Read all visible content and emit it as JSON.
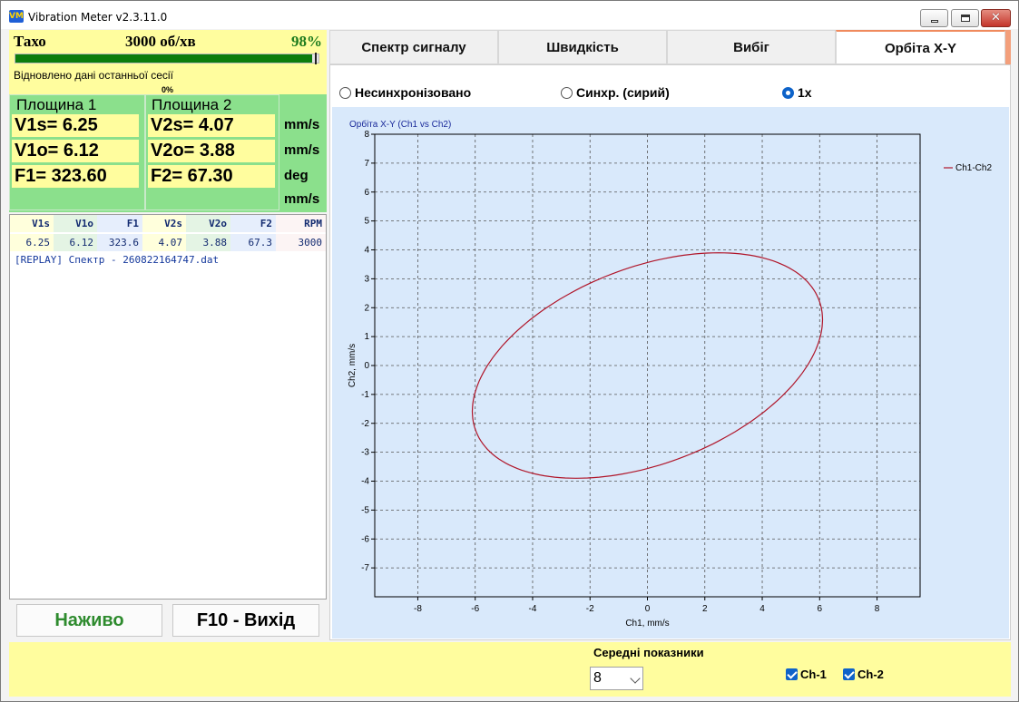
{
  "window": {
    "title": "Vibration Meter v2.3.11.0",
    "icon": "VM"
  },
  "tacho": {
    "label": "Тахо",
    "rpm": "3000 об/хв",
    "percent_text": "98%",
    "progress": 0.98,
    "status": "Відновлено дані останньої сесії",
    "small_percent": "0%"
  },
  "planes": {
    "plane1": {
      "title": "Площина 1",
      "v1s": "V1s= 6.25",
      "v1o": "V1o= 6.12",
      "f1": "F1= 323.60"
    },
    "plane2": {
      "title": "Площина 2",
      "v2s": "V2s= 4.07",
      "v2o": "V2o= 3.88",
      "f2": "F2= 67.30"
    },
    "units": [
      "mm/s",
      "mm/s",
      "deg",
      "mm/s"
    ]
  },
  "table": {
    "headers": [
      "V1s",
      "V1o",
      "F1",
      "V2s",
      "V2o",
      "F2",
      "RPM"
    ],
    "row": [
      "6.25",
      "6.12",
      "323.6",
      "4.07",
      "3.88",
      "67.3",
      "3000"
    ],
    "log": "[REPLAY] Спектр - 260822164747.dat"
  },
  "buttons": {
    "live": "Наживо",
    "exit": "F10 - Вихід"
  },
  "tabs": [
    "Спектр сигналу",
    "Швидкість",
    "Вибіг",
    "Орбіта X-Y"
  ],
  "active_tab": 3,
  "radios": {
    "options": [
      "Несинхронізовано",
      "Синхр. (сирий)",
      "1x"
    ],
    "selected": 2
  },
  "bottom": {
    "avg_label": "Середні показники",
    "avg_value": "8",
    "ch1": "Ch-1",
    "ch2": "Ch-2"
  },
  "colors": {
    "series": "#b0162a",
    "accent": "#0e63c9",
    "yellow_panel": "#fffd9e",
    "green_panel": "#8be08c",
    "chart_bg": "#d9e9fb"
  },
  "chart_data": {
    "type": "line",
    "title": "Орбіта X-Y (Ch1 vs Ch2)",
    "xlabel": "Ch1, mm/s",
    "ylabel": "Ch2, mm/s",
    "xlim": [
      -9.5,
      9.5
    ],
    "ylim": [
      -8,
      8
    ],
    "xticks": [
      -8,
      -6,
      -4,
      -2,
      0,
      2,
      4,
      6,
      8
    ],
    "yticks": [
      8,
      7,
      6,
      5,
      4,
      3,
      2,
      1,
      0,
      -1,
      -2,
      -3,
      -4,
      -5,
      -6,
      -7
    ],
    "grid": true,
    "legend": "top-right",
    "series": [
      {
        "name": "Ch1-Ch2",
        "orbit": {
          "x_amp": 6.1,
          "y_amp": 3.9,
          "phase_deg": 24,
          "x_center": 0,
          "y_center": 0
        }
      }
    ]
  }
}
